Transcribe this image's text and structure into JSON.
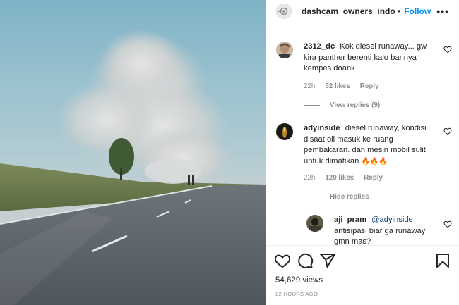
{
  "post": {
    "username": "dashcam_owners_indonesia",
    "dot": "•",
    "follow_label": "Follow",
    "more_label": "•••",
    "views": "54,629 views",
    "time_ago": "22 HOURS AGO"
  },
  "comments": [
    {
      "username": "2312_dc",
      "text": "Kok diesel runaway... gw kira panther berenti kalo bannya kempes doank",
      "age": "22h",
      "likes": "82 likes",
      "reply_label": "Reply",
      "replies_toggle": "View replies (9)"
    },
    {
      "username": "adyinside",
      "text": "diesel runaway, kondisi disaat oli masuk ke ruang pembakaran. dan mesin mobil sulit untuk dimatikan",
      "emoji": "🔥🔥🔥",
      "age": "22h",
      "likes": "120 likes",
      "reply_label": "Reply",
      "replies_toggle": "Hide replies"
    }
  ],
  "replies": [
    {
      "username": "aji_pram",
      "mention": "@adyinside",
      "text": "antisipasi biar ga runaway gmn mas?"
    }
  ],
  "icons": {
    "like": "heart-icon",
    "comment": "comment-icon",
    "share": "share-icon",
    "save": "bookmark-icon",
    "more": "more-options-icon"
  },
  "colors": {
    "accent": "#0095f6",
    "text": "#262626",
    "muted": "#8e8e8e",
    "mention": "#00376b"
  }
}
